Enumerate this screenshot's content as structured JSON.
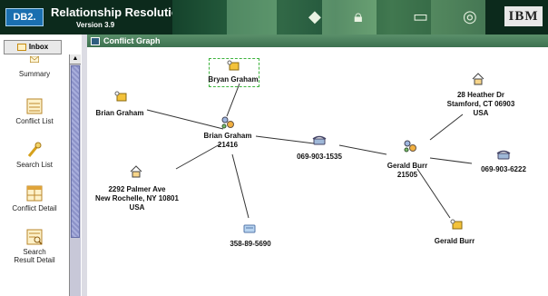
{
  "header": {
    "logo": "DB2.",
    "title": "Relationship Resolution",
    "version": "Version 3.9",
    "brand": "IBM"
  },
  "sidebar": {
    "inbox_label": "Inbox",
    "items": [
      {
        "label": "Summary",
        "icon": "summary-icon"
      },
      {
        "label": "Conflict List",
        "icon": "conflict-list-icon"
      },
      {
        "label": "Search List",
        "icon": "search-list-icon"
      },
      {
        "label": "Conflict Detail",
        "icon": "conflict-detail-icon"
      },
      {
        "label": "Search Result Detail",
        "icon": "search-result-detail-icon"
      }
    ]
  },
  "graph": {
    "title": "Conflict Graph",
    "nodes": {
      "bryan": {
        "label": "Bryan Graham",
        "icon": "person-card-icon"
      },
      "brian_left": {
        "label": "Brian Graham",
        "icon": "person-card-icon"
      },
      "brian_entity": {
        "label": "Brian Graham\n21416",
        "icon": "entity-icon"
      },
      "address_left": {
        "label": "2292 Palmer Ave\nNew Rochelle, NY 10801\nUSA",
        "icon": "house-icon"
      },
      "ssn": {
        "label": "358-89-5690",
        "icon": "id-card-icon"
      },
      "phone_mid": {
        "label": "069-903-1535",
        "icon": "phone-icon"
      },
      "address_right": {
        "label": "28 Heather Dr\nStamford, CT 06903\nUSA",
        "icon": "house-icon"
      },
      "gerald_entity": {
        "label": "Gerald Burr\n21505",
        "icon": "entity-icon"
      },
      "phone_right": {
        "label": "069-903-6222",
        "icon": "phone-icon"
      },
      "gerald_card": {
        "label": "Gerald Burr",
        "icon": "person-card-icon"
      }
    }
  },
  "colors": {
    "banner": "#0c2a1c",
    "title_bar": "#4a7f5c",
    "selection": "#3db33d",
    "scroll_thumb": "#8c92c8"
  }
}
